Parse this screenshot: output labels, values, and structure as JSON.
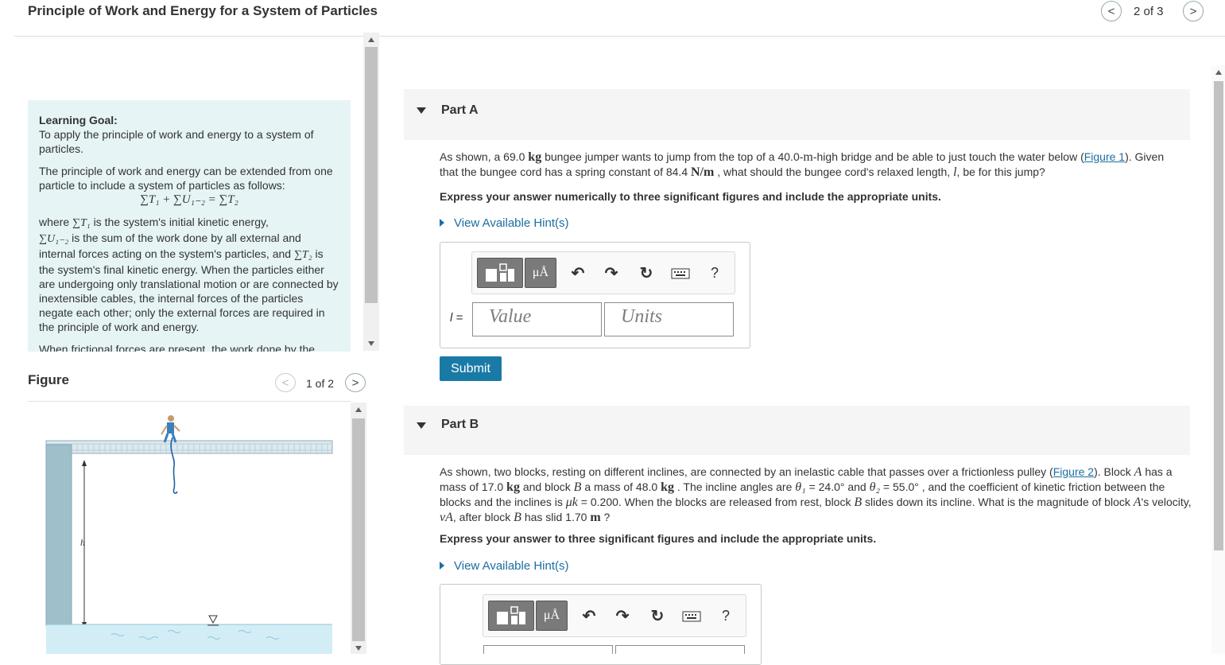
{
  "header": {
    "title": "Principle of Work and Energy for a System of Particles",
    "prev_icon": "<",
    "next_icon": ">",
    "count": "2 of 3"
  },
  "learning_goal": {
    "heading": "Learning Goal:",
    "goal": "To apply the principle of work and energy to a system of particles.",
    "p1": "The principle of work and energy can be extended from one particle to include a system of particles as follows:",
    "equation": "∑T₁ + ∑U₁₋₂ = ∑T₂",
    "where_1": "where",
    "sym_T1": "∑T₁",
    "where_2": "is the system's initial kinetic energy,",
    "sym_U": "∑U₁₋₂",
    "where_3": "is the sum of the work done by all external and internal forces acting on the system's particles, and",
    "sym_T2": "∑T₂",
    "where_4": "is the system's final kinetic energy. When the particles either are undergoing only translational motion or are connected by inextensible cables, the internal forces of the particles negate each other; only the external forces are required in the principle of work and energy.",
    "p3": "When frictional forces are present, the work done by the"
  },
  "figure": {
    "title": "Figure",
    "count": "1 of 2",
    "label_h": "h"
  },
  "part_a": {
    "label": "Part A",
    "t1": "As shown, a 69.0",
    "u_kg": "kg",
    "t2": "bungee jumper wants to jump from the top of a 40.0-",
    "u_m": "m",
    "t3": "-high bridge and be able to just touch the water below (",
    "fig_link": "Figure 1",
    "t4": "). Given that the bungee cord has a spring constant of 84.4",
    "u_nm": "N/m",
    "t5": ", what should the bungee cord's relaxed length,",
    "sym_l": "l",
    "t6": ", be for this jump?",
    "instruction": "Express your answer numerically to three significant figures and include the appropriate units.",
    "hint": "View Available Hint(s)",
    "var_label": "l =",
    "value_placeholder": "Value",
    "units_placeholder": "Units",
    "submit": "Submit"
  },
  "part_b": {
    "label": "Part B",
    "t1": "As shown, two blocks, resting on different inclines, are connected by an inelastic cable that passes over a frictionless pulley (",
    "fig_link": "Figure 2",
    "t2": "). Block",
    "sym_A": "A",
    "t3": "has a mass of 17.0",
    "u_kg1": "kg",
    "t4": "and block",
    "sym_B": "B",
    "t5": "a mass of 48.0",
    "u_kg2": "kg",
    "t6": ". The incline angles are",
    "sym_th1": "θ₁",
    "t7": "= 24.0° and",
    "sym_th2": "θ₂",
    "t8": "= 55.0° , and the coefficient of kinetic friction between the blocks and the inclines is",
    "sym_mu": "μk",
    "t9": "= 0.200. When the blocks are released from rest, block",
    "sym_B2": "B",
    "t10": "slides down its incline. What is the magnitude of block",
    "sym_A2": "A",
    "t11": "'s velocity,",
    "sym_vA": "vA",
    "t12": ", after block",
    "sym_B3": "B",
    "t13": "has slid 1.70",
    "u_m": "m",
    "t14": "?",
    "instruction": "Express your answer to three significant figures and include the appropriate units.",
    "hint": "View Available Hint(s)"
  },
  "toolbar": {
    "mu_label": "μÅ",
    "help": "?"
  }
}
